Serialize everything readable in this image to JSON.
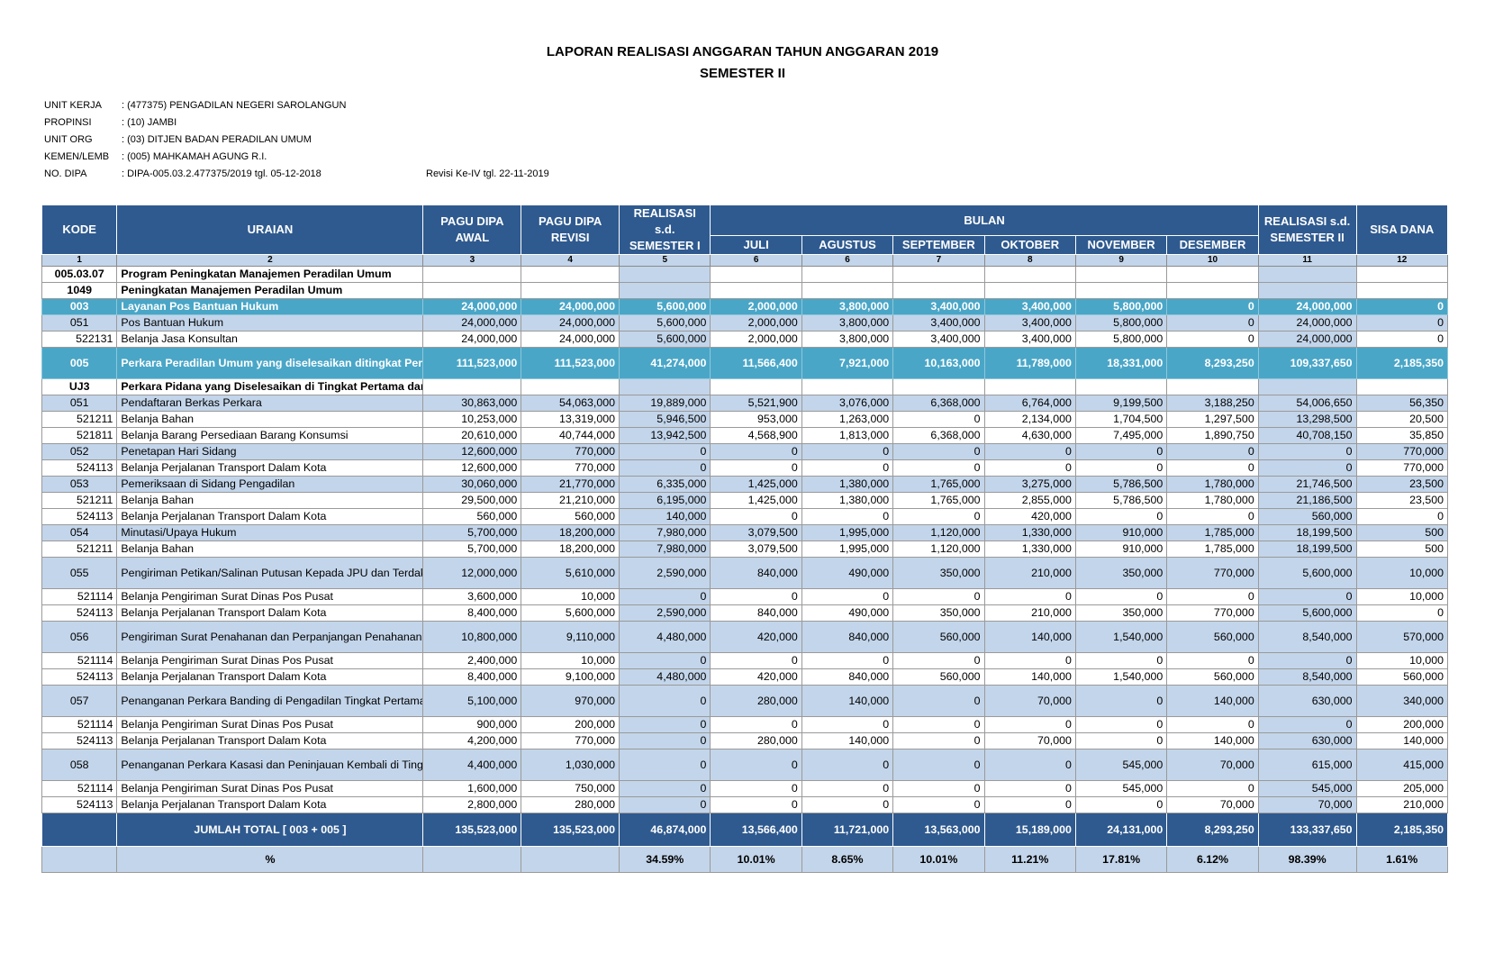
{
  "header": {
    "title": "LAPORAN REALISASI ANGGARAN TAHUN ANGGARAN 2019",
    "subtitle": "SEMESTER II"
  },
  "meta": [
    {
      "label": "UNIT KERJA",
      "value": ": (477375) PENGADILAN NEGERI SAROLANGUN"
    },
    {
      "label": "PROPINSI",
      "value": ": (10) JAMBI"
    },
    {
      "label": "UNIT ORG",
      "value": ": (03) DITJEN BADAN PERADILAN UMUM"
    },
    {
      "label": "KEMEN/LEMB",
      "value": ": (005) MAHKAMAH AGUNG R.I."
    },
    {
      "label": "NO. DIPA",
      "value": ": DIPA-005.03.2.477375/2019 tgl. 05-12-2018",
      "extra": "Revisi Ke-IV tgl. 22-11-2019"
    }
  ],
  "table": {
    "headers": {
      "kode": "KODE",
      "uraian": "URAIAN",
      "pagu_awal": "PAGU DIPA AWAL",
      "pagu_revisi": "PAGU DIPA REVISI",
      "real_sem1": "REALISASI s.d. SEMESTER I",
      "bulan": "BULAN",
      "months": [
        "JULI",
        "AGUSTUS",
        "SEPTEMBER",
        "OKTOBER",
        "NOVEMBER",
        "DESEMBER"
      ],
      "real_sem2": "REALISASI s.d. SEMESTER II",
      "sisa": "SISA DANA"
    },
    "col_numbers": [
      "1",
      "2",
      "3",
      "4",
      "5",
      "6",
      "6",
      "7",
      "8",
      "9",
      "10",
      "11",
      "12"
    ],
    "rows": [
      {
        "style": "white bold",
        "kode": "005.03.07",
        "kodeAlign": "c",
        "uraian": "Program Peningkatan Manajemen Peradilan Umum",
        "v": [
          "",
          "",
          "",
          "",
          "",
          "",
          "",
          "",
          "",
          "",
          ""
        ]
      },
      {
        "style": "white bold",
        "kode": "1049",
        "kodeAlign": "c",
        "uraian": "Peningkatan Manajemen Peradilan Umum",
        "v": [
          "",
          "",
          "",
          "",
          "",
          "",
          "",
          "",
          "",
          "",
          ""
        ]
      },
      {
        "style": "hl",
        "kode": "003",
        "kodeAlign": "c",
        "uraian": "Layanan Pos Bantuan Hukum",
        "v": [
          "24,000,000",
          "24,000,000",
          "5,600,000",
          "2,000,000",
          "3,800,000",
          "3,400,000",
          "3,400,000",
          "5,800,000",
          "0",
          "24,000,000",
          "0"
        ]
      },
      {
        "style": "sub",
        "kode": "051",
        "kodeAlign": "c",
        "uraian": "Pos Bantuan Hukum",
        "v": [
          "24,000,000",
          "24,000,000",
          "5,600,000",
          "2,000,000",
          "3,800,000",
          "3,400,000",
          "3,400,000",
          "5,800,000",
          "0",
          "24,000,000",
          "0"
        ]
      },
      {
        "style": "white",
        "kode": "522131",
        "uraian": "Belanja Jasa Konsultan",
        "v": [
          "24,000,000",
          "24,000,000",
          "5,600,000",
          "2,000,000",
          "3,800,000",
          "3,400,000",
          "3,400,000",
          "5,800,000",
          "0",
          "24,000,000",
          "0"
        ]
      },
      {
        "style": "hl",
        "kode": "005",
        "kodeAlign": "c",
        "wrap": true,
        "uraian": "Perkara Peradilan Umum yang diselesaikan ditingkat Pertama dan Banding yang Tepat Waktu",
        "v": [
          "111,523,000",
          "111,523,000",
          "41,274,000",
          "11,566,400",
          "7,921,000",
          "10,163,000",
          "11,789,000",
          "18,331,000",
          "8,293,250",
          "109,337,650",
          "2,185,350"
        ]
      },
      {
        "style": "white bold",
        "kode": "UJ3",
        "kodeAlign": "c",
        "uraian": "Perkara Pidana yang Diselesaikan di Tingkat Pertama dan Banding yang Tepat Waktu",
        "v": [
          "",
          "",
          "",
          "",
          "",
          "",
          "",
          "",
          "",
          "",
          ""
        ]
      },
      {
        "style": "sub",
        "kode": "051",
        "kodeAlign": "c",
        "uraian": "Pendaftaran Berkas Perkara",
        "v": [
          "30,863,000",
          "54,063,000",
          "19,889,000",
          "5,521,900",
          "3,076,000",
          "6,368,000",
          "6,764,000",
          "9,199,500",
          "3,188,250",
          "54,006,650",
          "56,350"
        ]
      },
      {
        "style": "white",
        "kode": "521211",
        "uraian": "Belanja Bahan",
        "v": [
          "10,253,000",
          "13,319,000",
          "5,946,500",
          "953,000",
          "1,263,000",
          "0",
          "2,134,000",
          "1,704,500",
          "1,297,500",
          "13,298,500",
          "20,500"
        ]
      },
      {
        "style": "white",
        "kode": "521811",
        "uraian": "Belanja Barang Persediaan Barang Konsumsi",
        "v": [
          "20,610,000",
          "40,744,000",
          "13,942,500",
          "4,568,900",
          "1,813,000",
          "6,368,000",
          "4,630,000",
          "7,495,000",
          "1,890,750",
          "40,708,150",
          "35,850"
        ]
      },
      {
        "style": "sub",
        "kode": "052",
        "kodeAlign": "c",
        "uraian": "Penetapan Hari Sidang",
        "v": [
          "12,600,000",
          "770,000",
          "0",
          "0",
          "0",
          "0",
          "0",
          "0",
          "0",
          "0",
          "770,000"
        ]
      },
      {
        "style": "white",
        "kode": "524113",
        "uraian": "Belanja Perjalanan Transport Dalam Kota",
        "v": [
          "12,600,000",
          "770,000",
          "0",
          "0",
          "0",
          "0",
          "0",
          "0",
          "0",
          "0",
          "770,000"
        ]
      },
      {
        "style": "sub",
        "kode": "053",
        "kodeAlign": "c",
        "uraian": "Pemeriksaan di Sidang Pengadilan",
        "v": [
          "30,060,000",
          "21,770,000",
          "6,335,000",
          "1,425,000",
          "1,380,000",
          "1,765,000",
          "3,275,000",
          "5,786,500",
          "1,780,000",
          "21,746,500",
          "23,500"
        ]
      },
      {
        "style": "white",
        "kode": "521211",
        "uraian": "Belanja Bahan",
        "v": [
          "29,500,000",
          "21,210,000",
          "6,195,000",
          "1,425,000",
          "1,380,000",
          "1,765,000",
          "2,855,000",
          "5,786,500",
          "1,780,000",
          "21,186,500",
          "23,500"
        ]
      },
      {
        "style": "white",
        "kode": "524113",
        "uraian": "Belanja Perjalanan Transport Dalam Kota",
        "v": [
          "560,000",
          "560,000",
          "140,000",
          "0",
          "0",
          "0",
          "420,000",
          "0",
          "0",
          "560,000",
          "0"
        ]
      },
      {
        "style": "sub",
        "kode": "054",
        "kodeAlign": "c",
        "uraian": "Minutasi/Upaya Hukum",
        "v": [
          "5,700,000",
          "18,200,000",
          "7,980,000",
          "3,079,500",
          "1,995,000",
          "1,120,000",
          "1,330,000",
          "910,000",
          "1,785,000",
          "18,199,500",
          "500"
        ]
      },
      {
        "style": "white",
        "kode": "521211",
        "uraian": "Belanja Bahan",
        "v": [
          "5,700,000",
          "18,200,000",
          "7,980,000",
          "3,079,500",
          "1,995,000",
          "1,120,000",
          "1,330,000",
          "910,000",
          "1,785,000",
          "18,199,500",
          "500"
        ]
      },
      {
        "style": "sub",
        "kode": "055",
        "kodeAlign": "c",
        "wrap": true,
        "uraian": "Pengiriman Petikan/Salinan Putusan Kepada JPU dan Terdakwa",
        "v": [
          "12,000,000",
          "5,610,000",
          "2,590,000",
          "840,000",
          "490,000",
          "350,000",
          "210,000",
          "350,000",
          "770,000",
          "5,600,000",
          "10,000"
        ]
      },
      {
        "style": "white",
        "kode": "521114",
        "uraian": "Belanja Pengiriman Surat Dinas Pos Pusat",
        "v": [
          "3,600,000",
          "10,000",
          "0",
          "0",
          "0",
          "0",
          "0",
          "0",
          "0",
          "0",
          "10,000"
        ]
      },
      {
        "style": "white",
        "kode": "524113",
        "uraian": "Belanja Perjalanan Transport Dalam Kota",
        "v": [
          "8,400,000",
          "5,600,000",
          "2,590,000",
          "840,000",
          "490,000",
          "350,000",
          "210,000",
          "350,000",
          "770,000",
          "5,600,000",
          "0"
        ]
      },
      {
        "style": "sub",
        "kode": "056",
        "kodeAlign": "c",
        "wrap": true,
        "uraian": "Pengiriman Surat Penahanan dan Perpanjangan Penahanan",
        "v": [
          "10,800,000",
          "9,110,000",
          "4,480,000",
          "420,000",
          "840,000",
          "560,000",
          "140,000",
          "1,540,000",
          "560,000",
          "8,540,000",
          "570,000"
        ]
      },
      {
        "style": "white",
        "kode": "521114",
        "uraian": "Belanja Pengiriman Surat Dinas Pos Pusat",
        "v": [
          "2,400,000",
          "10,000",
          "0",
          "0",
          "0",
          "0",
          "0",
          "0",
          "0",
          "0",
          "10,000"
        ]
      },
      {
        "style": "white",
        "kode": "524113",
        "uraian": "Belanja Perjalanan Transport Dalam Kota",
        "v": [
          "8,400,000",
          "9,100,000",
          "4,480,000",
          "420,000",
          "840,000",
          "560,000",
          "140,000",
          "1,540,000",
          "560,000",
          "8,540,000",
          "560,000"
        ]
      },
      {
        "style": "sub",
        "kode": "057",
        "kodeAlign": "c",
        "wrap": true,
        "uraian": "Penanganan Perkara Banding di Pengadilan Tingkat Pertama",
        "v": [
          "5,100,000",
          "970,000",
          "0",
          "280,000",
          "140,000",
          "0",
          "70,000",
          "0",
          "140,000",
          "630,000",
          "340,000"
        ]
      },
      {
        "style": "white",
        "kode": "521114",
        "uraian": "Belanja Pengiriman Surat Dinas Pos Pusat",
        "v": [
          "900,000",
          "200,000",
          "0",
          "0",
          "0",
          "0",
          "0",
          "0",
          "0",
          "0",
          "200,000"
        ]
      },
      {
        "style": "white",
        "kode": "524113",
        "uraian": "Belanja Perjalanan Transport Dalam Kota",
        "v": [
          "4,200,000",
          "770,000",
          "0",
          "280,000",
          "140,000",
          "0",
          "70,000",
          "0",
          "140,000",
          "630,000",
          "140,000"
        ]
      },
      {
        "style": "sub",
        "kode": "058",
        "kodeAlign": "c",
        "wrap": true,
        "uraian": "Penanganan Perkara Kasasi dan Peninjauan Kembali di Tingkat Pertama",
        "v": [
          "4,400,000",
          "1,030,000",
          "0",
          "0",
          "0",
          "0",
          "0",
          "545,000",
          "70,000",
          "615,000",
          "415,000"
        ]
      },
      {
        "style": "white",
        "kode": "521114",
        "uraian": "Belanja Pengiriman Surat Dinas Pos Pusat",
        "v": [
          "1,600,000",
          "750,000",
          "0",
          "0",
          "0",
          "0",
          "0",
          "545,000",
          "0",
          "545,000",
          "205,000"
        ]
      },
      {
        "style": "white",
        "kode": "524113",
        "uraian": "Belanja Perjalanan Transport Dalam Kota",
        "v": [
          "2,800,000",
          "280,000",
          "0",
          "0",
          "0",
          "0",
          "0",
          "0",
          "70,000",
          "70,000",
          "210,000"
        ]
      }
    ],
    "total": {
      "label": "JUMLAH TOTAL [ 003 + 005 ]",
      "v": [
        "135,523,000",
        "135,523,000",
        "46,874,000",
        "13,566,400",
        "11,721,000",
        "13,563,000",
        "15,189,000",
        "24,131,000",
        "8,293,250",
        "133,337,650",
        "2,185,350"
      ]
    },
    "percent": {
      "label": "%",
      "v": [
        "",
        "",
        "34.59%",
        "10.01%",
        "8.65%",
        "10.01%",
        "11.21%",
        "17.81%",
        "6.12%",
        "98.39%",
        "1.61%"
      ]
    }
  }
}
